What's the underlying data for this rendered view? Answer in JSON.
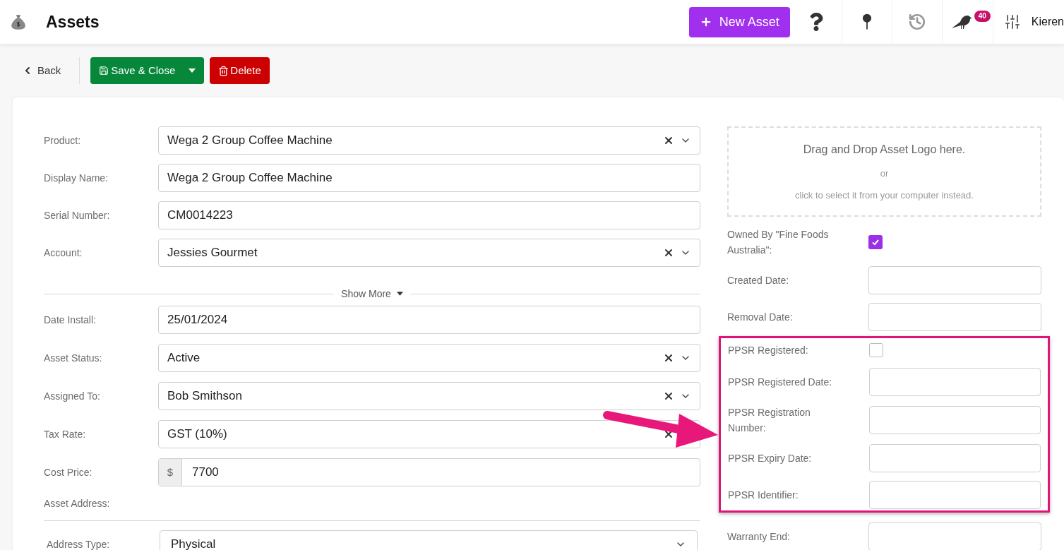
{
  "header": {
    "title": "Assets",
    "new_button": "New Asset",
    "notification_count": "40",
    "user_name": "Kieren"
  },
  "toolbar": {
    "back": "Back",
    "save": "Save & Close",
    "delete": "Delete"
  },
  "left_fields": [
    {
      "label": "Product:",
      "kind": "select",
      "value": "Wega 2 Group Coffee Machine"
    },
    {
      "label": "Display Name:",
      "kind": "text",
      "value": "Wega 2 Group Coffee Machine"
    },
    {
      "label": "Serial Number:",
      "kind": "text",
      "value": "CM0014223"
    },
    {
      "label": "Account:",
      "kind": "select",
      "value": "Jessies Gourmet"
    }
  ],
  "show_more": "Show More",
  "more_fields": [
    {
      "label": "Date Install:",
      "kind": "text",
      "value": "25/01/2024"
    },
    {
      "label": "Asset Status:",
      "kind": "select",
      "value": "Active"
    },
    {
      "label": "Assigned To:",
      "kind": "select",
      "value": "Bob Smithson"
    },
    {
      "label": "Tax Rate:",
      "kind": "select",
      "value": "GST (10%)"
    },
    {
      "label": "Cost Price:",
      "kind": "currency",
      "prefix": "$",
      "value": "7700"
    }
  ],
  "asset_address": {
    "label": "Asset Address:",
    "type_label": "Address Type:",
    "type_value": "Physical"
  },
  "dropzone": {
    "title": "Drag and Drop Asset Logo here.",
    "or": "or",
    "hint": "click to select it from your computer instead."
  },
  "right_fields": [
    {
      "label": "Owned By \"Fine Foods Australia\":",
      "kind": "checkbox",
      "checked": true
    },
    {
      "label": "Created Date:",
      "kind": "text"
    },
    {
      "label": "Removal Date:",
      "kind": "text"
    }
  ],
  "ppsr_fields": [
    {
      "label": "PPSR Registered:",
      "kind": "checkbox",
      "checked": false
    },
    {
      "label": "PPSR Registered Date:",
      "kind": "text"
    },
    {
      "label": "PPSR Registration Number:",
      "kind": "text"
    },
    {
      "label": "PPSR Expiry Date:",
      "kind": "text"
    },
    {
      "label": "PPSR Identifier:",
      "kind": "text"
    }
  ],
  "after_fields": [
    {
      "label": "Warranty End:",
      "kind": "text"
    }
  ]
}
